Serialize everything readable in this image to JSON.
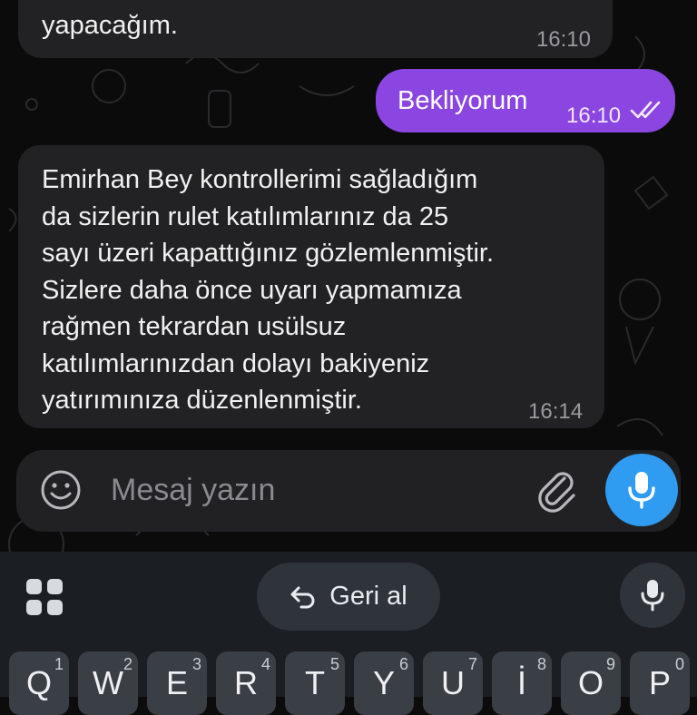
{
  "messages": [
    {
      "direction": "incoming",
      "text": "yapacağım.",
      "time": "16:10"
    },
    {
      "direction": "outgoing",
      "text": "Bekliyorum",
      "time": "16:10",
      "status": "read-double-check"
    },
    {
      "direction": "incoming",
      "text": "Emirhan Bey kontrollerimi sağladığım\nda sizlerin rulet katılımlarınız da 25\nsayı üzeri kapattığınız gözlemlenmiştir.\nSizlere daha önce uyarı yapmamıza\nrağmen tekrardan usülsuz\nkatılımlarınızdan dolayı bakiyeniz\nyatırımınıza düzenlenmiştir.",
      "time": "16:14"
    }
  ],
  "composer": {
    "placeholder": "Mesaj yazın",
    "emoji_icon": "smiley-icon",
    "attach_icon": "paperclip-icon",
    "mic_icon": "microphone-icon"
  },
  "keyboard": {
    "undo_label": "Geri al",
    "keys": [
      {
        "letter": "Q",
        "num": "1"
      },
      {
        "letter": "W",
        "num": "2"
      },
      {
        "letter": "E",
        "num": "3"
      },
      {
        "letter": "R",
        "num": "4"
      },
      {
        "letter": "T",
        "num": "5"
      },
      {
        "letter": "Y",
        "num": "6"
      },
      {
        "letter": "U",
        "num": "7"
      },
      {
        "letter": "İ",
        "num": "8"
      },
      {
        "letter": "O",
        "num": "9"
      },
      {
        "letter": "P",
        "num": "0"
      }
    ]
  },
  "colors": {
    "outgoing_bubble": "#8b45e0",
    "incoming_bubble": "#222224",
    "mic_button": "#2f9cf2"
  }
}
